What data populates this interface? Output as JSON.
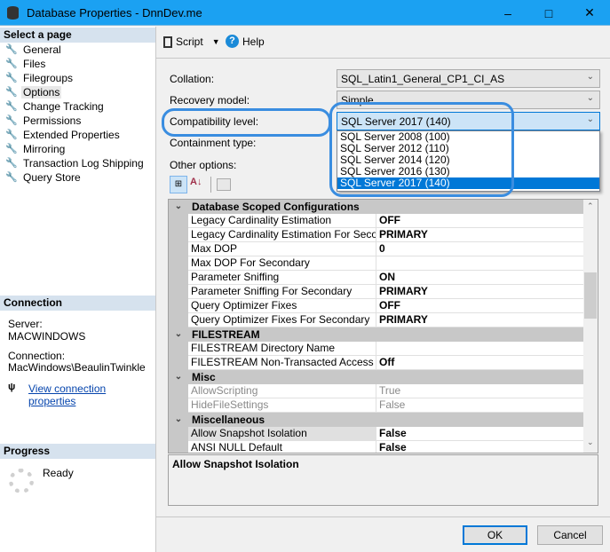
{
  "window": {
    "title": "Database Properties - DnnDev.me"
  },
  "left": {
    "select_header": "Select a page",
    "pages": [
      "General",
      "Files",
      "Filegroups",
      "Options",
      "Change Tracking",
      "Permissions",
      "Extended Properties",
      "Mirroring",
      "Transaction Log Shipping",
      "Query Store"
    ],
    "selected": "Options",
    "connection_header": "Connection",
    "server_label": "Server:",
    "server": "MACWINDOWS",
    "connection_label": "Connection:",
    "connection": "MacWindows\\BeaulinTwinkle",
    "view_link": "View connection properties",
    "progress_header": "Progress",
    "progress_status": "Ready"
  },
  "toolbar": {
    "script": "Script",
    "help": "Help"
  },
  "form": {
    "collation_label": "Collation:",
    "collation": "SQL_Latin1_General_CP1_CI_AS",
    "recovery_label": "Recovery model:",
    "recovery": "Simple",
    "compat_label": "Compatibility level:",
    "compat": "SQL Server 2017 (140)",
    "containment_label": "Containment type:",
    "other_label": "Other options:",
    "compat_options": [
      "SQL Server 2008 (100)",
      "SQL Server 2012 (110)",
      "SQL Server 2014 (120)",
      "SQL Server 2016 (130)",
      "SQL Server 2017 (140)"
    ]
  },
  "grid": {
    "rows": [
      {
        "cat": "Database Scoped Configurations"
      },
      {
        "n": "Legacy Cardinality Estimation",
        "v": "OFF"
      },
      {
        "n": "Legacy Cardinality Estimation For Secondary",
        "v": "PRIMARY"
      },
      {
        "n": "Max DOP",
        "v": "0"
      },
      {
        "n": "Max DOP For Secondary",
        "v": ""
      },
      {
        "n": "Parameter Sniffing",
        "v": "ON"
      },
      {
        "n": "Parameter Sniffing For Secondary",
        "v": "PRIMARY"
      },
      {
        "n": "Query Optimizer Fixes",
        "v": "OFF"
      },
      {
        "n": "Query Optimizer Fixes For Secondary",
        "v": "PRIMARY"
      },
      {
        "cat": "FILESTREAM"
      },
      {
        "n": "FILESTREAM Directory Name",
        "v": ""
      },
      {
        "n": "FILESTREAM Non-Transacted Access",
        "v": "Off"
      },
      {
        "cat": "Misc"
      },
      {
        "n": "AllowScripting",
        "v": "True",
        "dis": true
      },
      {
        "n": "HideFileSettings",
        "v": "False",
        "dis": true
      },
      {
        "cat": "Miscellaneous"
      },
      {
        "n": "Allow Snapshot Isolation",
        "v": "False",
        "sel": true
      },
      {
        "n": "ANSI NULL Default",
        "v": "False"
      }
    ]
  },
  "description": {
    "title": "Allow Snapshot Isolation"
  },
  "buttons": {
    "ok": "OK",
    "cancel": "Cancel"
  },
  "colors": {
    "titlebar": "#1ba1f2",
    "highlight": "#3a8de0",
    "selection": "#0078d7"
  }
}
